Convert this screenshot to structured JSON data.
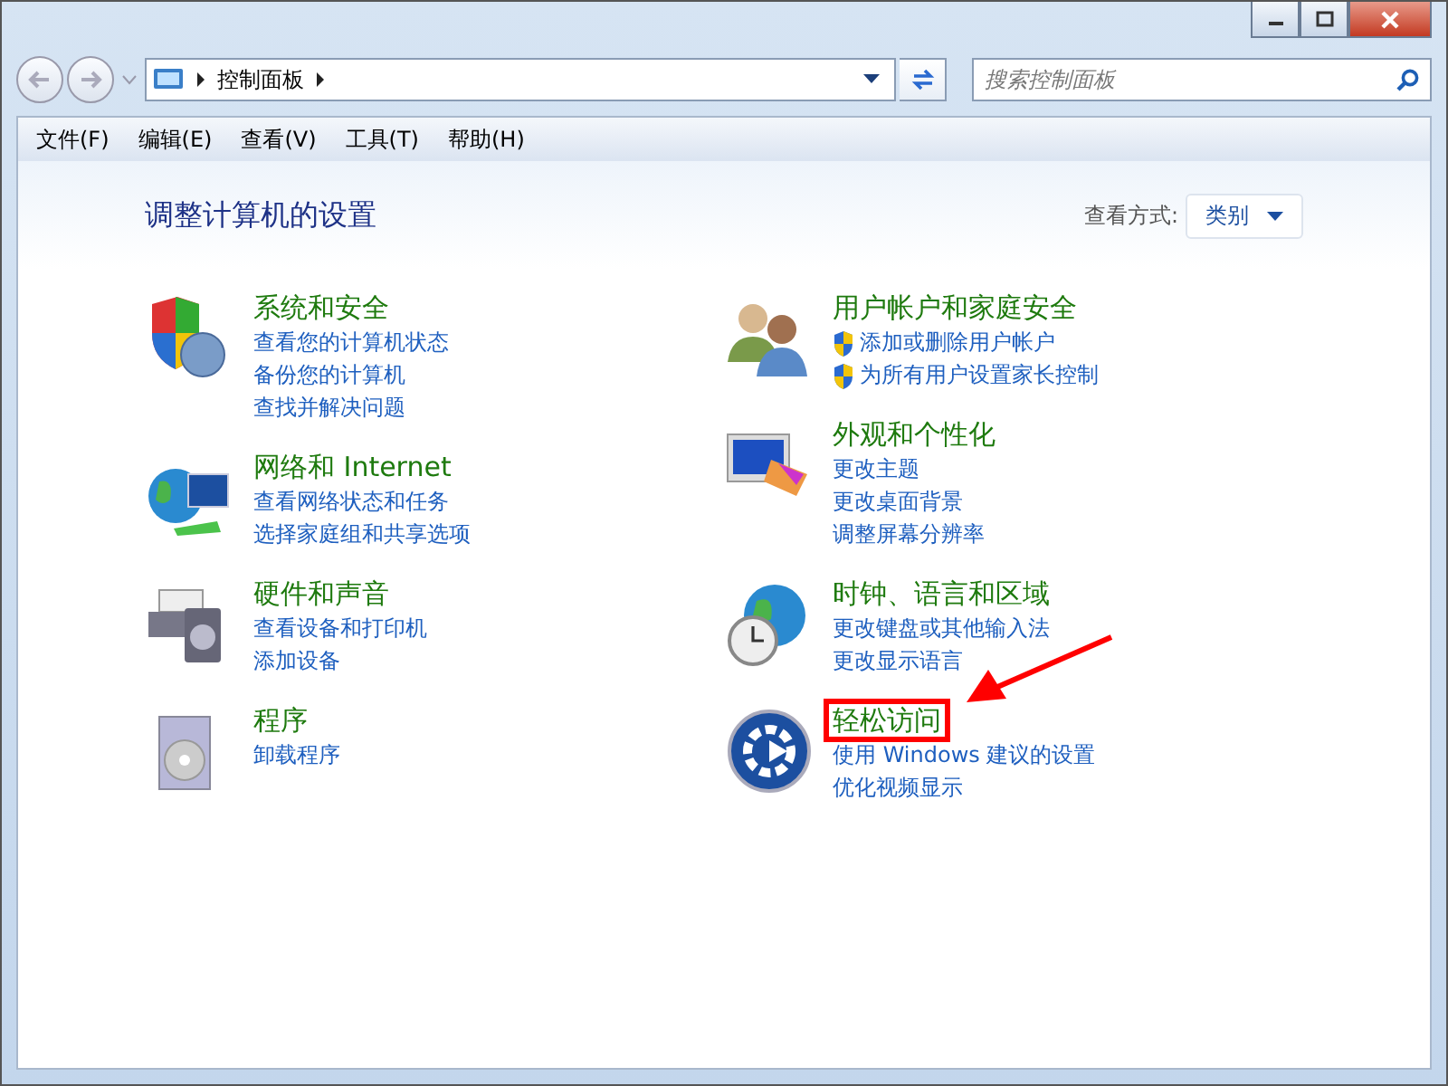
{
  "address_bar": {
    "crumbs": [
      "控制面板"
    ]
  },
  "search": {
    "placeholder": "搜索控制面板"
  },
  "menu": [
    "文件(F)",
    "编辑(E)",
    "查看(V)",
    "工具(T)",
    "帮助(H)"
  ],
  "heading": "调整计算机的设置",
  "view_by": {
    "label": "查看方式:",
    "value": "类别"
  },
  "columns": [
    [
      {
        "title": "系统和安全",
        "kind": "security",
        "annotated": false,
        "links": [
          {
            "text": "查看您的计算机状态",
            "shield": false
          },
          {
            "text": "备份您的计算机",
            "shield": false
          },
          {
            "text": "查找并解决问题",
            "shield": false
          }
        ]
      },
      {
        "title": "网络和 Internet",
        "kind": "network",
        "annotated": false,
        "links": [
          {
            "text": "查看网络状态和任务",
            "shield": false
          },
          {
            "text": "选择家庭组和共享选项",
            "shield": false
          }
        ]
      },
      {
        "title": "硬件和声音",
        "kind": "hardware",
        "annotated": false,
        "links": [
          {
            "text": "查看设备和打印机",
            "shield": false
          },
          {
            "text": "添加设备",
            "shield": false
          }
        ]
      },
      {
        "title": "程序",
        "kind": "programs",
        "annotated": false,
        "links": [
          {
            "text": "卸载程序",
            "shield": false
          }
        ]
      }
    ],
    [
      {
        "title": "用户帐户和家庭安全",
        "kind": "users",
        "annotated": false,
        "links": [
          {
            "text": "添加或删除用户帐户",
            "shield": true
          },
          {
            "text": "为所有用户设置家长控制",
            "shield": true
          }
        ]
      },
      {
        "title": "外观和个性化",
        "kind": "appearance",
        "annotated": false,
        "links": [
          {
            "text": "更改主题",
            "shield": false
          },
          {
            "text": "更改桌面背景",
            "shield": false
          },
          {
            "text": "调整屏幕分辨率",
            "shield": false
          }
        ]
      },
      {
        "title": "时钟、语言和区域",
        "kind": "clock",
        "annotated": false,
        "links": [
          {
            "text": "更改键盘或其他输入法",
            "shield": false
          },
          {
            "text": "更改显示语言",
            "shield": false
          }
        ]
      },
      {
        "title": "轻松访问",
        "kind": "access",
        "annotated": true,
        "links": [
          {
            "text": "使用 Windows 建议的设置",
            "shield": false
          },
          {
            "text": "优化视频显示",
            "shield": false
          }
        ]
      }
    ]
  ]
}
